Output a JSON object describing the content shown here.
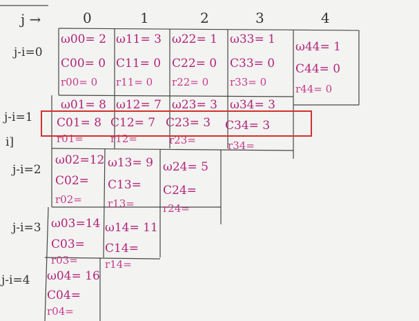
{
  "header": {
    "j_label": "j →",
    "columns": [
      "0",
      "1",
      "2",
      "3",
      "4"
    ]
  },
  "rows": {
    "labels": [
      "j-i=0",
      "j-i=1",
      "j-i=2",
      "j-i=3",
      "j-i=4"
    ],
    "extra_label": "i]"
  },
  "cells": {
    "r0": [
      {
        "w": "ω00= 2",
        "c": "C00= 0",
        "r": "r00= 0"
      },
      {
        "w": "ω11= 3",
        "c": "C11= 0",
        "r": "r11= 0"
      },
      {
        "w": "ω22= 1",
        "c": "C22= 0",
        "r": "r22= 0"
      },
      {
        "w": "ω33= 1",
        "c": "C33= 0",
        "r": "r33= 0"
      },
      {
        "w": "ω44= 1",
        "c": "C44= 0",
        "r": "r44= 0"
      }
    ],
    "r1": [
      {
        "w": "ω01= 8",
        "c": "C01= 8",
        "r": "r01="
      },
      {
        "w": "ω12= 7",
        "c": "C12= 7",
        "r": "r12="
      },
      {
        "w": "ω23= 3",
        "c": "C23= 3",
        "r": "r23="
      },
      {
        "w": "ω34= 3",
        "c": "C34= 3",
        "r": "r34="
      }
    ],
    "r2": [
      {
        "w": "ω02=12",
        "c": "C02=",
        "r": "r02="
      },
      {
        "w": "ω13= 9",
        "c": "C13=",
        "r": "r13="
      },
      {
        "w": "ω24= 5",
        "c": "C24=",
        "r": "r24="
      }
    ],
    "r3": [
      {
        "w": "ω03=14",
        "c": "C03=",
        "r": "r03="
      },
      {
        "w": "ω14= 11",
        "c": "C14=",
        "r": "r14="
      }
    ],
    "r4": [
      {
        "w": "ω04= 16",
        "c": "C04=",
        "r": "r04="
      }
    ]
  },
  "colors": {
    "ink": "#333333",
    "marker_pink": "#b0247a",
    "highlight_red": "#d0312d"
  }
}
